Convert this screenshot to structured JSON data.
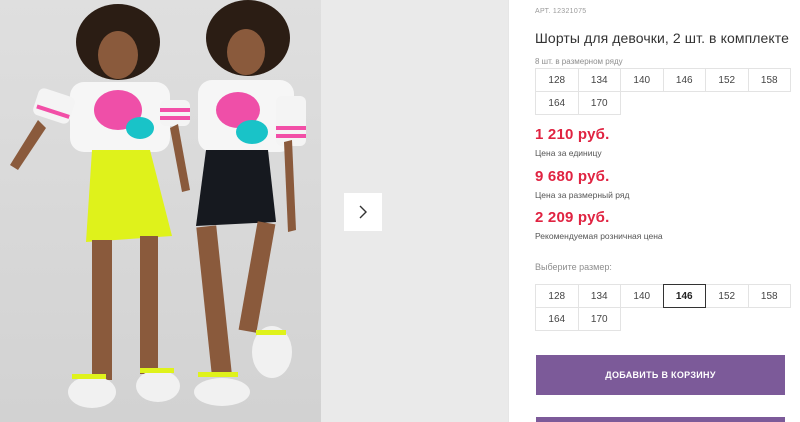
{
  "product": {
    "article": "АРТ. 12321075",
    "title": "Шорты для девочки, 2 шт. в комплекте"
  },
  "size_row": {
    "label": "8 шт. в размерном ряду",
    "sizes": [
      "128",
      "134",
      "140",
      "146",
      "152",
      "158",
      "164",
      "170"
    ]
  },
  "prices": {
    "unit_price": "1 210 руб.",
    "unit_caption": "Цена за единицу",
    "row_price": "9 680 руб.",
    "row_caption": "Цена за размерный ряд",
    "retail_price": "2 209 руб.",
    "retail_caption": "Рекомендуемая розничная цена"
  },
  "size_picker": {
    "label": "Выберите размер:",
    "sizes": [
      "128",
      "134",
      "140",
      "146",
      "152",
      "158",
      "164",
      "170"
    ],
    "selected": "146"
  },
  "actions": {
    "add_to_cart": "ДОБАВИТЬ В КОРЗИНУ"
  },
  "colors": {
    "accent": "#7c5a99",
    "price": "#e02341"
  },
  "icons": {
    "next": "chevron-right-icon"
  }
}
